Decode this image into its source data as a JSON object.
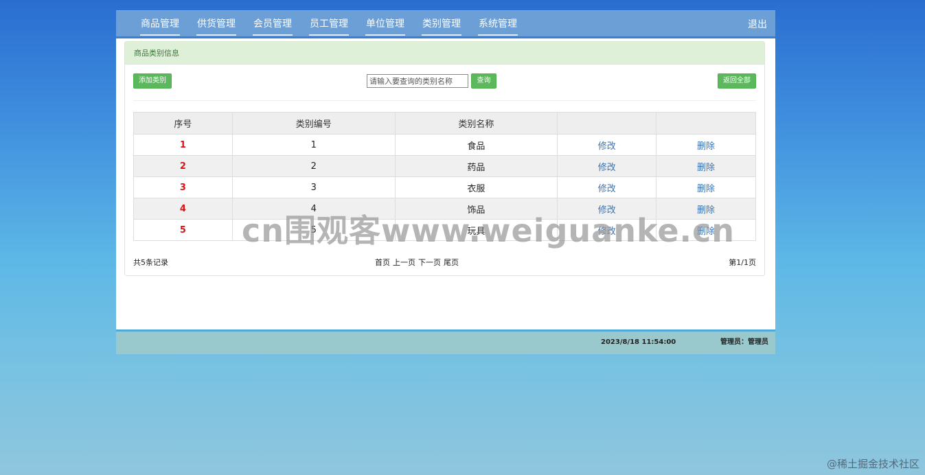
{
  "nav": {
    "items": [
      "商品管理",
      "供货管理",
      "会员管理",
      "员工管理",
      "单位管理",
      "类别管理",
      "系统管理"
    ],
    "logout": "退出"
  },
  "panel": {
    "title": "商品类别信息"
  },
  "toolbar": {
    "add_label": "添加类别",
    "search_placeholder": "请输入要查询的类别名称",
    "search_label": "查询",
    "all_label": "返回全部"
  },
  "table": {
    "headers": [
      "序号",
      "类别编号",
      "类别名称",
      "",
      ""
    ],
    "rows": [
      {
        "seq": "1",
        "code": "1",
        "name": "食品",
        "edit": "修改",
        "delete": "删除"
      },
      {
        "seq": "2",
        "code": "2",
        "name": "药品",
        "edit": "修改",
        "delete": "删除"
      },
      {
        "seq": "3",
        "code": "3",
        "name": "衣服",
        "edit": "修改",
        "delete": "删除"
      },
      {
        "seq": "4",
        "code": "4",
        "name": "饰品",
        "edit": "修改",
        "delete": "删除"
      },
      {
        "seq": "5",
        "code": "5",
        "name": "玩具",
        "edit": "修改",
        "delete": "删除"
      }
    ]
  },
  "pager": {
    "total": "共5条记录",
    "first": "首页",
    "prev": "上一页",
    "next": "下一页",
    "last": "尾页",
    "page_info": "第1/1页"
  },
  "footer": {
    "datetime": "2023/8/18 11:54:00",
    "admin": "管理员：管理员"
  },
  "overlay": {
    "watermark": "cn围观客www.weiguanke.cn",
    "corner": "@稀土掘金技术社区"
  }
}
